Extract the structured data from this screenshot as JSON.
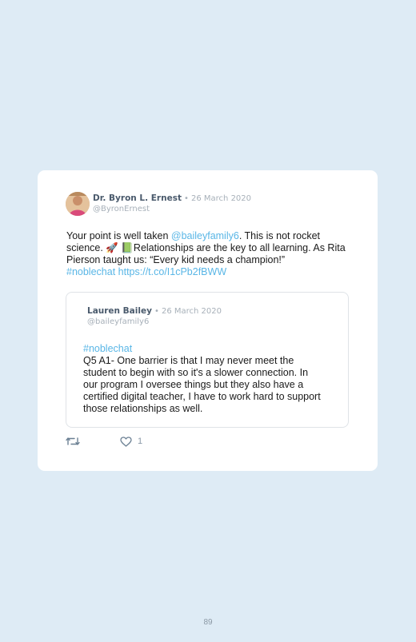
{
  "tweet": {
    "author_name": "Dr. Byron L. Ernest",
    "separator": "•",
    "date": "26 March 2020",
    "handle": "@ByronErnest",
    "text_before_mention": "Your point is well taken ",
    "mention": "@baileyfamily6",
    "text_after_mention": ". This is not rocket science. 🚀 📗Relationships are the key to all learning. As Rita Pierson taught us: “Every kid needs a champion!”",
    "hashtag": "#noblechat",
    "link": "https://t.co/I1cPb2fBWW"
  },
  "quoted_tweet": {
    "author_name": "Lauren Bailey",
    "separator": "•",
    "date": "26 March 2020",
    "handle": "@baileyfamily6",
    "hashtag": "#noblechat",
    "text": "Q5 A1- One barrier is that I may never meet the student to begin with so it's a slower connection. In our program I oversee things but they also have a certified digital teacher, I have to work hard to support those relationships as well."
  },
  "actions": {
    "retweet_icon": "retweet-icon",
    "like_icon": "heart-icon",
    "like_count": "1"
  },
  "page": {
    "number": "89"
  },
  "colors": {
    "background": "#deebf5",
    "link": "#59b6e6"
  }
}
